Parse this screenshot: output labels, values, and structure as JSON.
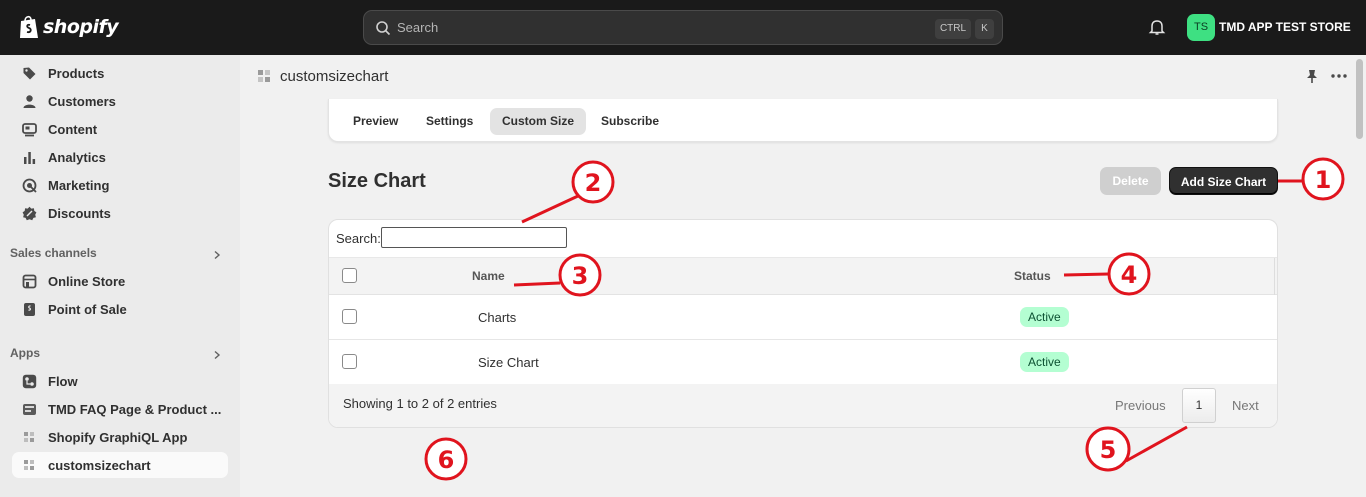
{
  "topbar": {
    "logo_text": "shopify",
    "search_placeholder": "Search",
    "shortcut_ctrl": "CTRL",
    "shortcut_k": "K",
    "store_initials": "TS",
    "store_name": "TMD APP TEST STORE"
  },
  "sidebar": {
    "items": [
      {
        "label": "Products",
        "icon": "tag-icon"
      },
      {
        "label": "Customers",
        "icon": "person-icon"
      },
      {
        "label": "Content",
        "icon": "content-icon"
      },
      {
        "label": "Analytics",
        "icon": "bar-chart-icon"
      },
      {
        "label": "Marketing",
        "icon": "target-icon"
      },
      {
        "label": "Discounts",
        "icon": "discount-icon"
      }
    ],
    "sales_channels_title": "Sales channels",
    "sales_channels": [
      {
        "label": "Online Store",
        "icon": "store-icon"
      },
      {
        "label": "Point of Sale",
        "icon": "pos-icon"
      }
    ],
    "apps_title": "Apps",
    "apps": [
      {
        "label": "Flow",
        "icon": "flow-icon"
      },
      {
        "label": "TMD FAQ Page & Product ...",
        "icon": "app-icon"
      },
      {
        "label": "Shopify GraphiQL App",
        "icon": "app-icon"
      },
      {
        "label": "customsizechart",
        "icon": "app-icon",
        "active": true
      }
    ]
  },
  "app_header": {
    "title": "customsizechart"
  },
  "tabs": [
    {
      "label": "Preview"
    },
    {
      "label": "Settings"
    },
    {
      "label": "Custom Size",
      "active": true
    },
    {
      "label": "Subscribe"
    }
  ],
  "page": {
    "title": "Size Chart",
    "delete_label": "Delete",
    "add_label": "Add Size Chart"
  },
  "table": {
    "search_label": "Search:",
    "search_value": "",
    "columns": [
      "Name",
      "Status"
    ],
    "rows": [
      {
        "name": "Charts",
        "status": "Active"
      },
      {
        "name": "Size Chart",
        "status": "Active"
      }
    ],
    "info": "Showing 1 to 2 of 2 entries",
    "prev_label": "Previous",
    "page_number": "1",
    "next_label": "Next"
  },
  "annotations": [
    "1",
    "2",
    "3",
    "4",
    "5",
    "6"
  ],
  "colors": {
    "topbar": "#1a1a1a",
    "annotation_red": "#e0141e",
    "badge_bg": "#b4fed2",
    "badge_text": "#0c5132",
    "store_avatar": "#3ee082"
  }
}
